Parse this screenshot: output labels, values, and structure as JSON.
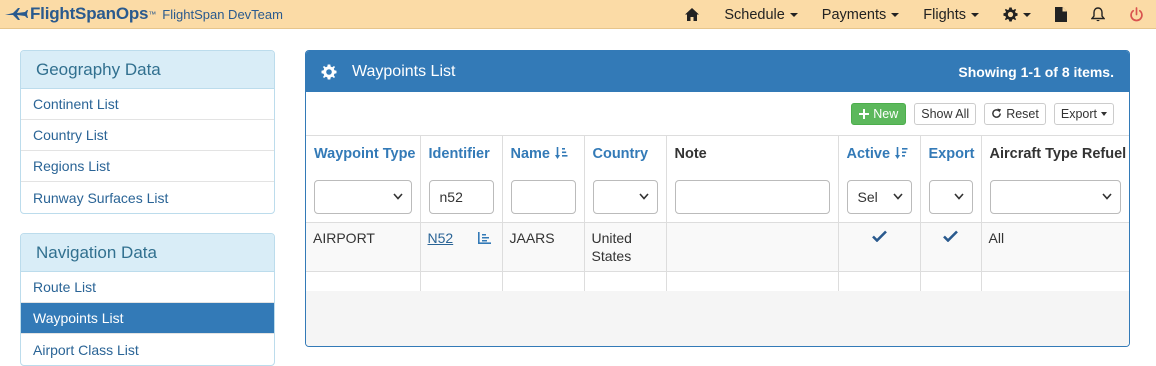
{
  "navbar": {
    "brand": "FlightSpanOps",
    "trademark": "™",
    "team": "FlightSpan DevTeam",
    "menus": [
      "Schedule",
      "Payments",
      "Flights"
    ],
    "colors": {
      "background": "#fbdba6",
      "brand": "#2a5a8e",
      "logout": "#d9534f"
    }
  },
  "sidebar": {
    "geography": {
      "title": "Geography Data",
      "items": [
        "Continent List",
        "Country List",
        "Regions List",
        "Runway Surfaces List"
      ]
    },
    "navigation": {
      "title": "Navigation Data",
      "items": [
        "Route List",
        "Waypoints List",
        "Airport Class List"
      ],
      "active": "Waypoints List"
    }
  },
  "panel": {
    "title": "Waypoints List",
    "summary": "Showing 1-1 of 8 items.",
    "accent": "#337ab7"
  },
  "toolbar": {
    "new_label": "New",
    "show_all_label": "Show All",
    "reset_label": "Reset",
    "export_label": "Export"
  },
  "table": {
    "columns": [
      "Waypoint Type",
      "Identifier",
      "Name",
      "Country",
      "Note",
      "Active",
      "Export",
      "Aircraft Type Refuel"
    ],
    "filters": {
      "identifier": "n52",
      "active": "Sel"
    },
    "rows": [
      {
        "waypoint_type": "AIRPORT",
        "identifier": "N52",
        "name": "JAARS",
        "country_line1": "United",
        "country_line2": "States",
        "note": "",
        "active": true,
        "export": true,
        "aircraft_type_refuel": "All"
      }
    ]
  }
}
